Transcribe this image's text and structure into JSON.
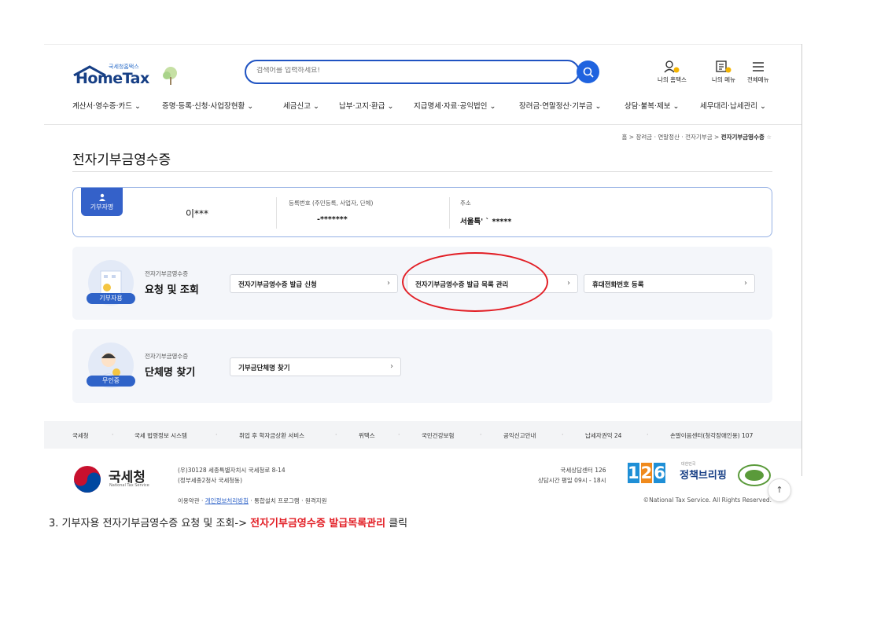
{
  "header": {
    "logo_small": "국세청홈택스",
    "logo_brand": "HomeTax",
    "search_placeholder": "검색어를 입력하세요!",
    "util": [
      {
        "label": "나의 홈택스"
      },
      {
        "label": "나의 메뉴"
      },
      {
        "label": "전체메뉴"
      }
    ]
  },
  "gnb": [
    "계산서·영수증·카드 ⌄",
    "증명·등록·신청·사업장현황 ⌄",
    "세금신고 ⌄",
    "납부·고지·환급 ⌄",
    "지급명세·자료·공익법인 ⌄",
    "장려금·연말정산·기부금 ⌄",
    "상담·불복·제보 ⌄",
    "세무대리·납세관리 ⌄"
  ],
  "breadcrumb": {
    "home": "홈",
    "path": "장려금 · 연말정산 · 전자기부금",
    "current": "전자기부금영수증",
    "sep": ">"
  },
  "page_title": "전자기부금영수증",
  "donor": {
    "tag": "기부자명",
    "name": "이***",
    "reg_label": "등록번호 (주민등록, 사업자, 단체)",
    "reg_value": "-*******",
    "addr_label": "주소",
    "addr_value": "서울특'         ` *****"
  },
  "panel1": {
    "badge": "기부자용",
    "subtitle": "전자기부금영수증",
    "title": "요청 및 조회",
    "links": [
      "전자기부금영수증 발급 신청",
      "전자기부금영수증 발급 목록 관리",
      "휴대전화번호 등록"
    ]
  },
  "panel2": {
    "badge": "무인증",
    "subtitle": "전자기부금영수증",
    "title": "단체명 찾기",
    "links": [
      "기부금단체명 찾기"
    ]
  },
  "footer": {
    "nav": [
      "국세청",
      "국세 법령정보 시스템",
      "취업 후 학자금상환 서비스",
      "위택스",
      "국민건강보험",
      "공익신고안내",
      "납세자권익 24",
      "손말이음센터(청각장애인용) 107"
    ],
    "org_name": "국세청",
    "org_en": "National Tax Service",
    "addr1": "(우)30128 세종특별자치시 국세청로 8-14",
    "addr2": "(정부세종2청사 국세청동)",
    "call1": "국세상담센터 126",
    "call2": "상담시간 평일 09시 - 18시",
    "brief_small": "대한민국",
    "brief": "정책브리핑",
    "links": [
      "이용약관",
      "개인정보처리방침",
      "통합설치 프로그램",
      "원격지원"
    ],
    "copyright": "©National Tax Service. All Rights Reserved."
  },
  "caption": {
    "pre": "3. 기부자용 전자기부금영수증 요청 및 조회->",
    "highlight": "전자기부금영수증 발급목록관리",
    "post": "클릭"
  },
  "colors": {
    "primary": "#1f63df",
    "navy": "#173f85",
    "highlight": "#e21e25"
  }
}
